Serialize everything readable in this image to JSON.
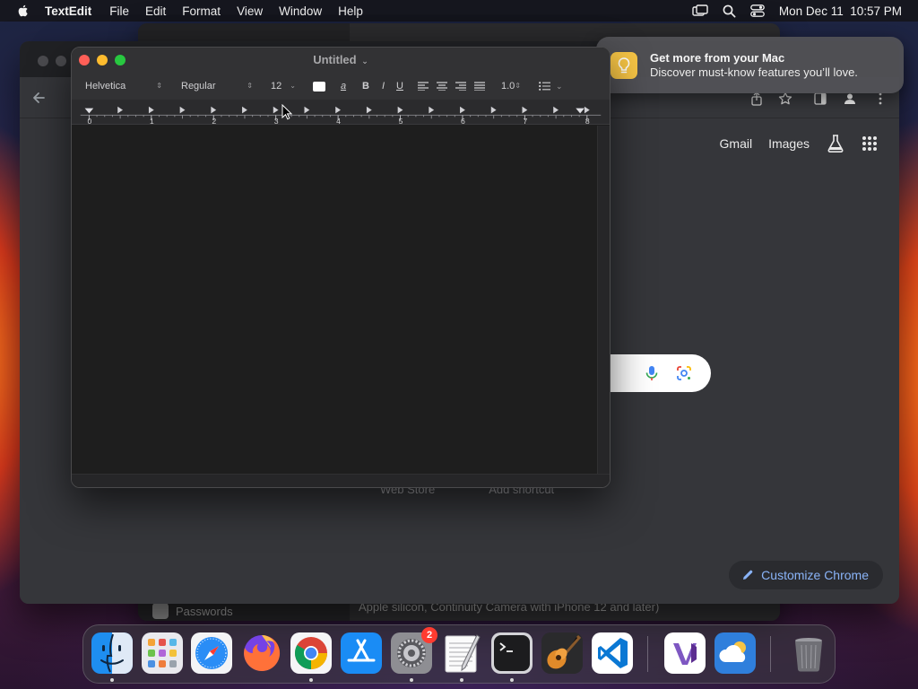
{
  "menubar": {
    "app_name": "TextEdit",
    "items": [
      "File",
      "Edit",
      "Format",
      "View",
      "Window",
      "Help"
    ],
    "date_time": "Mon Dec 11  10:57 PM"
  },
  "settings_window": {
    "sidebar_item": "Passwords",
    "footer_text": "Apple silicon, Continuity Camera with iPhone 12 and later)"
  },
  "chrome": {
    "top_links": [
      "Gmail",
      "Images"
    ],
    "shortcuts": [
      "Web Store",
      "Add shortcut"
    ],
    "customize_label": "Customize Chrome"
  },
  "notification": {
    "title": "Get more from your Mac",
    "body": "Discover must-know features you’ll love."
  },
  "textedit": {
    "title": "Untitled",
    "font_family": "Helvetica",
    "font_style": "Regular",
    "font_size": "12",
    "bold": "B",
    "italic": "I",
    "underline": "U",
    "line_spacing": "1.0",
    "ruler_numbers": [
      "0",
      "1",
      "2",
      "3",
      "4",
      "5",
      "6",
      "7",
      "8"
    ]
  },
  "dock": {
    "apps": [
      "Finder",
      "Launchpad",
      "Safari",
      "Firefox",
      "Google Chrome",
      "App Store",
      "System Settings",
      "TextEdit",
      "Terminal",
      "GarageBand",
      "Visual Studio Code",
      "Visual Studio",
      "Weather",
      "Trash"
    ],
    "settings_badge": "2"
  },
  "colors": {
    "close": "#ff5f57",
    "minimize": "#febc2e",
    "zoom": "#28c840",
    "chrome_link": "#8ab4f8",
    "badge": "#ff3b30"
  }
}
